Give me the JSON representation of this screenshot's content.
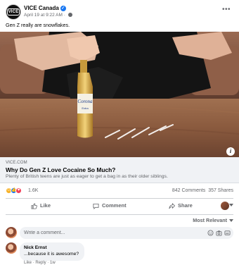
{
  "post": {
    "page_name": "VICE Canada",
    "timestamp": "April 19 at 9:22 AM",
    "caption": "Gen Z really are snowflakes."
  },
  "link": {
    "domain": "VICE.COM",
    "title": "Why Do Gen Z Love Cocaine So Much?",
    "description": "Plenty of British teens are just as eager to get a bag in as their older siblings."
  },
  "stats": {
    "reactions_count": "1.6K",
    "comments": "842 Comments",
    "shares": "357 Shares"
  },
  "actions": {
    "like": "Like",
    "comment": "Comment",
    "share": "Share"
  },
  "comments": {
    "sort_label": "Most Relevant",
    "placeholder": "Write a comment...",
    "items": [
      {
        "author": "Nick Ernst",
        "text": "...because it is awesome?",
        "meta": "Like · Reply · 1w"
      }
    ]
  },
  "icons": {
    "page_logo": "VICE"
  },
  "colors": {
    "accent": "#1877f2",
    "secondary_text": "#65676b",
    "link_card_bg": "#f0f2f5"
  }
}
